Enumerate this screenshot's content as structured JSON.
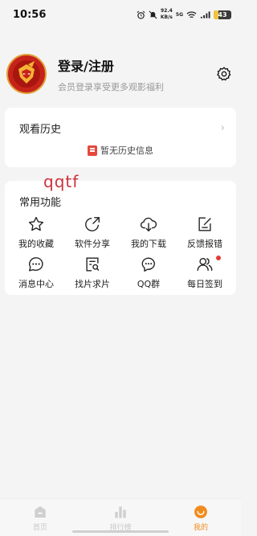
{
  "status_bar": {
    "time": "10:56",
    "speed_value": "92.4",
    "speed_unit": "KB/s",
    "network": "5G",
    "battery": "43",
    "icons": [
      "alarm-icon",
      "mute-icon",
      "wifi-icon",
      "signal-icon",
      "battery-icon"
    ]
  },
  "profile": {
    "title": "登录/注册",
    "subtitle": "会员登录享受更多观影福利",
    "avatar_icon": "hero-logo-icon",
    "settings_icon": "gear-icon"
  },
  "history": {
    "title": "观看历史",
    "empty_text": "暂无历史信息"
  },
  "watermark": "qqtf",
  "features": {
    "title": "常用功能",
    "items": [
      {
        "label": "我的收藏",
        "icon": "star-icon"
      },
      {
        "label": "软件分享",
        "icon": "share-icon"
      },
      {
        "label": "我的下载",
        "icon": "cloud-download-icon"
      },
      {
        "label": "反馈报错",
        "icon": "edit-icon"
      },
      {
        "label": "消息中心",
        "icon": "chat-icon"
      },
      {
        "label": "找片求片",
        "icon": "search-doc-icon"
      },
      {
        "label": "QQ群",
        "icon": "group-chat-icon"
      },
      {
        "label": "每日签到",
        "icon": "users-icon"
      }
    ]
  },
  "bottom_nav": {
    "items": [
      {
        "label": "首页",
        "icon": "home-icon",
        "active": false
      },
      {
        "label": "排行榜",
        "icon": "ranking-icon",
        "active": false
      },
      {
        "label": "我的",
        "icon": "smile-icon",
        "active": true
      }
    ]
  },
  "colors": {
    "accent": "#f08c1e",
    "badge_red": "#e53935",
    "background": "#f4f4f4"
  }
}
